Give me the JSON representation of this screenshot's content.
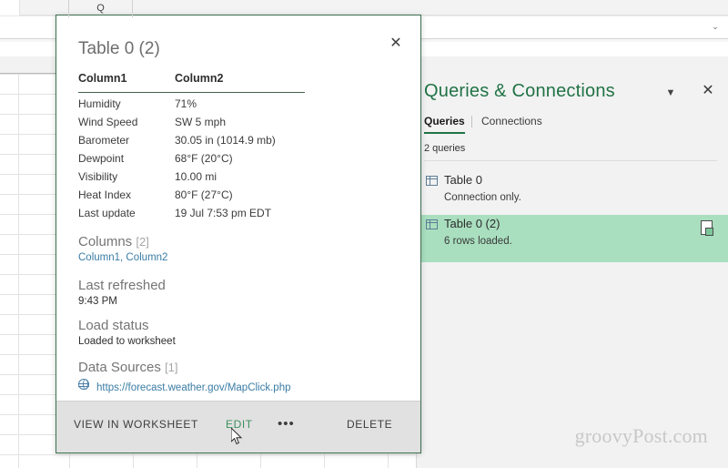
{
  "app": {
    "formula_bar_chevron": "⌄",
    "column_header": "Q",
    "watermark": "groovyPost.com"
  },
  "queries_pane": {
    "title": "Queries & Connections",
    "caret_icon": "▼",
    "close_icon": "✕",
    "tabs": [
      {
        "label": "Queries",
        "active": true
      },
      {
        "label": "Connections",
        "active": false
      }
    ],
    "count_label": "2 queries",
    "items": [
      {
        "name": "Table 0",
        "status": "Connection only.",
        "selected": false
      },
      {
        "name": "Table 0 (2)",
        "status": "6 rows loaded.",
        "selected": true
      }
    ],
    "pointer_icon": "❯"
  },
  "peek": {
    "title": "Table 0 (2)",
    "close_icon": "✕",
    "table": {
      "headers": [
        "Column1",
        "Column2"
      ],
      "rows": [
        [
          "Humidity",
          "71%"
        ],
        [
          "Wind Speed",
          "SW 5 mph"
        ],
        [
          "Barometer",
          "30.05 in (1014.9 mb)"
        ],
        [
          "Dewpoint",
          "68°F (20°C)"
        ],
        [
          "Visibility",
          "10.00 mi"
        ],
        [
          "Heat Index",
          "80°F (27°C)"
        ],
        [
          "Last update",
          "19 Jul 7:53 pm EDT"
        ]
      ]
    },
    "sections": {
      "columns": {
        "heading": "Columns",
        "count": "[2]",
        "value": "Column1, Column2"
      },
      "last_refreshed": {
        "heading": "Last refreshed",
        "value": "9:43 PM"
      },
      "load_status": {
        "heading": "Load status",
        "value": "Loaded to worksheet"
      },
      "data_sources": {
        "heading": "Data Sources",
        "count": "[1]",
        "url": "https://forecast.weather.gov/MapClick.php"
      }
    },
    "actions": {
      "view_in_worksheet": "VIEW IN WORKSHEET",
      "edit": "EDIT",
      "more": "•••",
      "delete": "DELETE"
    }
  },
  "colors": {
    "excel_green": "#217346",
    "selection_green": "#a9dfbf",
    "link_blue": "#3a7ca5",
    "hover_green": "#3f8f5e"
  }
}
